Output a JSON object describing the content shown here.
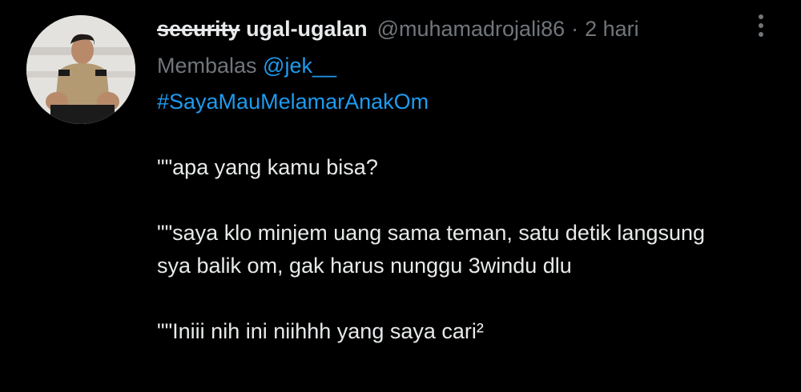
{
  "tweet": {
    "avatar_icon": "profile-photo-avatar",
    "display_name_strike": "security",
    "display_name_rest": " ugal-ugalan",
    "handle": "@muhamadrojali86",
    "separator": "·",
    "timestamp": "2 hari",
    "more_icon": "vertical-ellipsis-icon",
    "reply_prefix": "Membalas ",
    "reply_mention": "@jek__",
    "hashtag": "#SayaMauMelamarAnakOm",
    "paragraphs": [
      "\"\"apa yang kamu bisa?",
      "\"\"saya klo minjem uang sama teman, satu detik langsung sya balik om, gak harus nunggu 3windu dlu",
      "\"\"Iniii nih ini niihhh yang saya cari²"
    ]
  },
  "colors": {
    "background": "#000000",
    "text": "#e7e9ea",
    "muted": "#71767b",
    "link": "#1d9bf0"
  }
}
